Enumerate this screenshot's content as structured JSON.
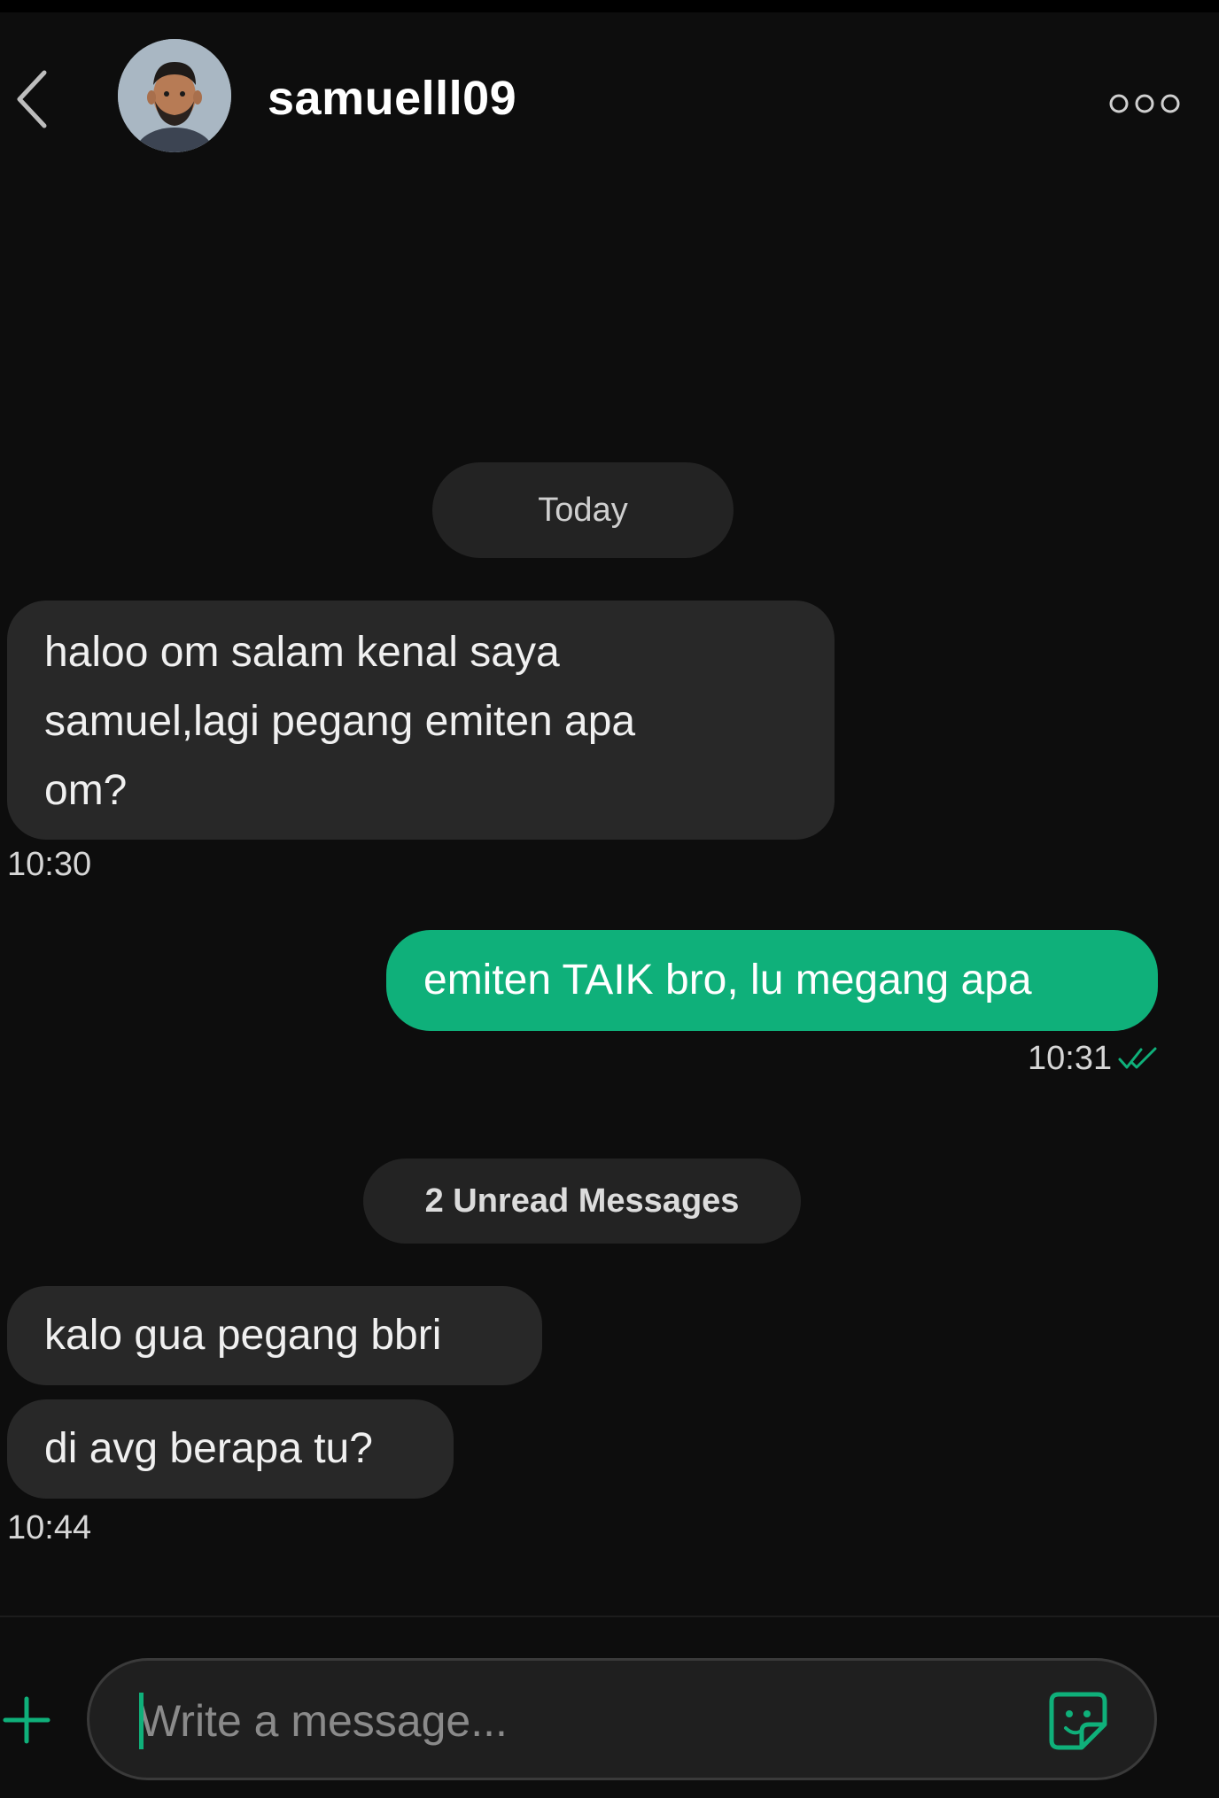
{
  "header": {
    "username": "samuelll09",
    "back_icon": "chevron-left-icon",
    "more_icon": "more-options-icon"
  },
  "chat": {
    "date_separator": "Today",
    "messages": [
      {
        "direction": "incoming",
        "text_lines": [
          "haloo om salam kenal saya",
          "samuel,lagi pegang emiten apa",
          "om?"
        ],
        "time": "10:30"
      },
      {
        "direction": "outgoing",
        "text": "emiten TAIK bro, lu megang apa",
        "time": "10:31",
        "status": "read"
      },
      {
        "direction": "incoming",
        "text": "kalo gua pegang bbri"
      },
      {
        "direction": "incoming",
        "text": "di avg berapa tu?",
        "time": "10:44"
      }
    ],
    "unread_label": "2 Unread Messages"
  },
  "composer": {
    "placeholder": "Write a message...",
    "add_icon": "plus-icon",
    "sticker_icon": "sticker-icon"
  },
  "colors": {
    "accent": "#0fb07a",
    "background": "#0d0d0d",
    "bubble_incoming": "#282828"
  }
}
